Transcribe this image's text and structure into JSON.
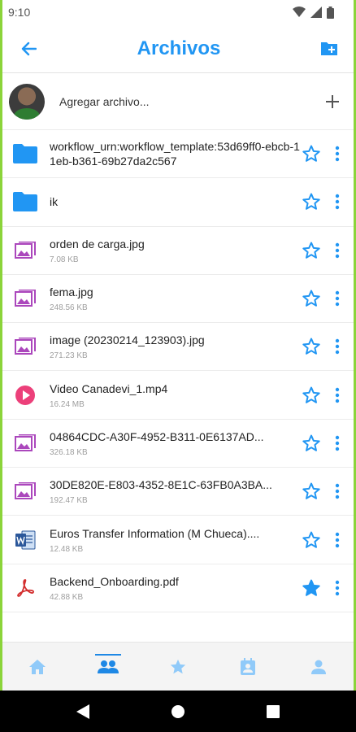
{
  "status_bar": {
    "time": "9:10"
  },
  "app_bar": {
    "title": "Archivos"
  },
  "add_row": {
    "placeholder": "Agregar archivo..."
  },
  "files": [
    {
      "name": "workflow_urn:workflow_template:53d69ff0-ebcb-11eb-b361-69b27da2c567",
      "size": "",
      "type": "folder",
      "starred": false
    },
    {
      "name": "ik",
      "size": "",
      "type": "folder",
      "starred": false
    },
    {
      "name": "orden de carga.jpg",
      "size": "7.08 KB",
      "type": "image",
      "starred": false
    },
    {
      "name": "fema.jpg",
      "size": "248.56 KB",
      "type": "image",
      "starred": false
    },
    {
      "name": "image (20230214_123903).jpg",
      "size": "271.23 KB",
      "type": "image",
      "starred": false
    },
    {
      "name": "Video Canadevi_1.mp4",
      "size": "16.24 MB",
      "type": "video",
      "starred": false
    },
    {
      "name": "04864CDC-A30F-4952-B311-0E6137AD...",
      "size": "326.18 KB",
      "type": "image",
      "starred": false
    },
    {
      "name": "30DE820E-E803-4352-8E1C-63FB0A3BA...",
      "size": "192.47 KB",
      "type": "image",
      "starred": false
    },
    {
      "name": "Euros Transfer Information (M Chueca)....",
      "size": "12.48 KB",
      "type": "word",
      "starred": false
    },
    {
      "name": "Backend_Onboarding.pdf",
      "size": "42.88 KB",
      "type": "pdf",
      "starred": true
    }
  ],
  "bottom_nav": [
    {
      "icon": "home-icon",
      "active": false
    },
    {
      "icon": "people-icon",
      "active": true
    },
    {
      "icon": "star-icon",
      "active": false
    },
    {
      "icon": "contacts-icon",
      "active": false
    },
    {
      "icon": "person-icon",
      "active": false
    }
  ],
  "colors": {
    "accent": "#2196f3",
    "folder": "#2196f3",
    "image": "#ab47bc",
    "video": "#ec407a",
    "word": "#2b579a",
    "pdf": "#d32f2f",
    "frame": "#8bd43a"
  }
}
